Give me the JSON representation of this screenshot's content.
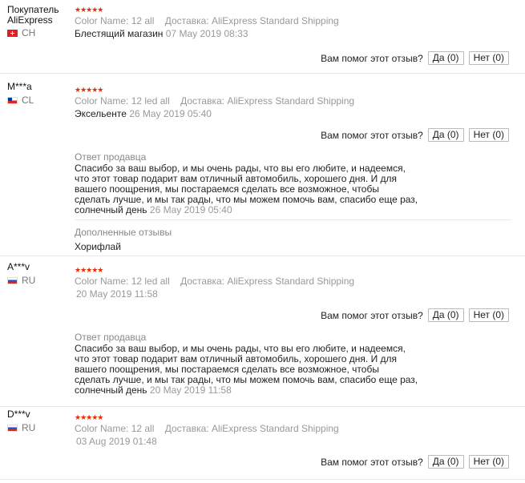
{
  "helpful_question": "Вам помог этот отзыв?",
  "reviews": [
    {
      "user": "Покупатель AliExpress",
      "country": "CH",
      "color_label": "Color Name:",
      "color_value": "12 all",
      "ship_label": "Доставка:",
      "ship_value": "AliExpress Standard Shipping",
      "text": "Блестящий магазин",
      "date": "07 May 2019 08:33",
      "yes": "Да (0)",
      "no": "Нет (0)"
    },
    {
      "user": "M***a",
      "country": "CL",
      "color_label": "Color Name:",
      "color_value": "12 led all",
      "ship_label": "Доставка:",
      "ship_value": "AliExpress Standard Shipping",
      "text": "Эксельенте",
      "date": "26 May 2019 05:40",
      "yes": "Да (0)",
      "no": "Нет (0)",
      "reply_title": "Ответ продавца",
      "reply_text": "Спасибо за ваш выбор, и мы очень рады, что вы его любите, и надеемся,\nчто этот товар подарит вам отличный автомобиль, хорошего дня. И для\nвашего поощрения, мы постараемся сделать все возможное, чтобы\nсделать лучше, и мы так рады, что мы можем помочь вам, спасибо еще раз,\nсолнечный день",
      "reply_date": "26 May 2019 05:40",
      "extra_title": "Дополненные отзывы",
      "extra_text": "Хорифлай"
    },
    {
      "user": "A***v",
      "country": "RU",
      "color_label": "Color Name:",
      "color_value": "12 led all",
      "ship_label": "Доставка:",
      "ship_value": "AliExpress Standard Shipping",
      "date": "20 May 2019 11:58",
      "yes": "Да (0)",
      "no": "Нет (0)",
      "reply_title": "Ответ продавца",
      "reply_text": "Спасибо за ваш выбор, и мы очень рады, что вы его любите, и надеемся,\nчто этот товар подарит вам отличный автомобиль, хорошего дня. И для\nвашего поощрения, мы постараемся сделать все возможное, чтобы\nсделать лучше, и мы так рады, что мы можем помочь вам, спасибо еще раз,\nсолнечный день",
      "reply_date": "20 May 2019 11:58"
    },
    {
      "user": "D***v",
      "country": "RU",
      "color_label": "Color Name:",
      "color_value": "12 all",
      "ship_label": "Доставка:",
      "ship_value": "AliExpress Standard Shipping",
      "date": "03 Aug 2019 01:48",
      "yes": "Да (0)",
      "no": "Нет (0)"
    }
  ],
  "star_glyphs": "★★★★★",
  "colors": {
    "star": "#e62e04",
    "muted": "#999999",
    "border": "#e8e8e8"
  }
}
